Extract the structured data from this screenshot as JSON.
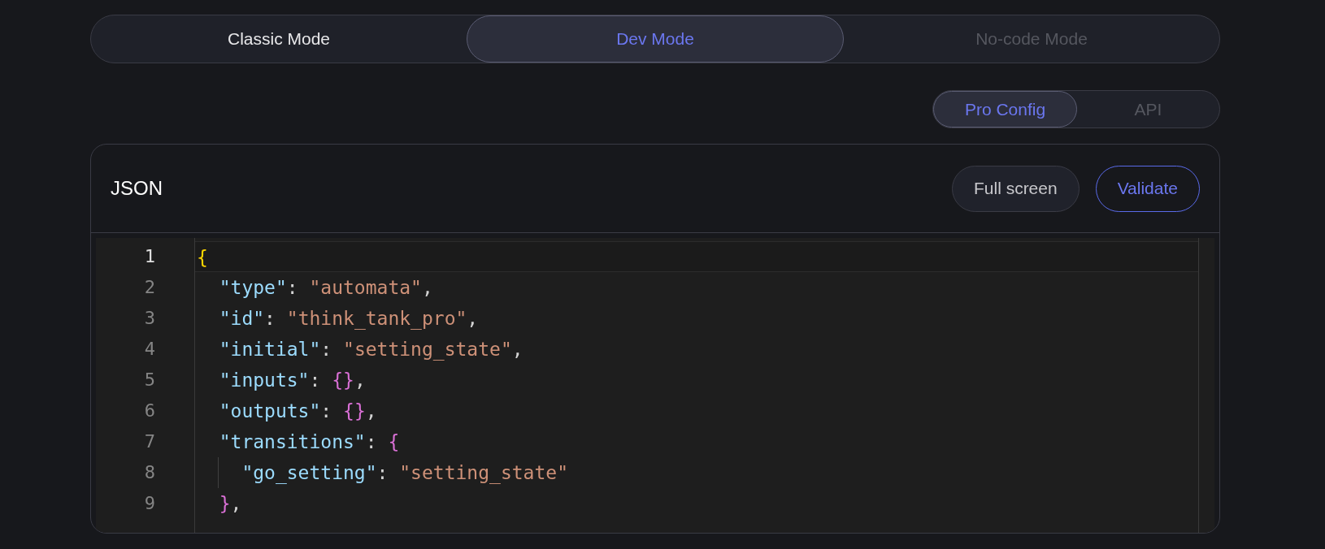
{
  "mode_tabs": [
    {
      "label": "Classic Mode",
      "selected": false,
      "disabled": false
    },
    {
      "label": "Dev Mode",
      "selected": true,
      "disabled": false
    },
    {
      "label": "No-code Mode",
      "selected": false,
      "disabled": true
    }
  ],
  "config_tabs": [
    {
      "label": "Pro Config",
      "selected": true
    },
    {
      "label": "API",
      "selected": false
    }
  ],
  "editor_card": {
    "title": "JSON",
    "buttons": [
      {
        "label": "Full screen",
        "kind": "secondary"
      },
      {
        "label": "Validate",
        "kind": "outline"
      }
    ],
    "lines": [
      {
        "number": "1",
        "active": true,
        "tokens": [
          {
            "kind": "bracket1",
            "text": "{"
          }
        ]
      },
      {
        "number": "2",
        "active": false,
        "tokens": [
          {
            "kind": "key",
            "text": "  \"type\""
          },
          {
            "kind": "punct",
            "text": ": "
          },
          {
            "kind": "string",
            "text": "\"automata\""
          },
          {
            "kind": "punct",
            "text": ","
          }
        ]
      },
      {
        "number": "3",
        "active": false,
        "tokens": [
          {
            "kind": "key",
            "text": "  \"id\""
          },
          {
            "kind": "punct",
            "text": ": "
          },
          {
            "kind": "string",
            "text": "\"think_tank_pro\""
          },
          {
            "kind": "punct",
            "text": ","
          }
        ]
      },
      {
        "number": "4",
        "active": false,
        "tokens": [
          {
            "kind": "key",
            "text": "  \"initial\""
          },
          {
            "kind": "punct",
            "text": ": "
          },
          {
            "kind": "string",
            "text": "\"setting_state\""
          },
          {
            "kind": "punct",
            "text": ","
          }
        ]
      },
      {
        "number": "5",
        "active": false,
        "tokens": [
          {
            "kind": "key",
            "text": "  \"inputs\""
          },
          {
            "kind": "punct",
            "text": ": "
          },
          {
            "kind": "bracket2",
            "text": "{}"
          },
          {
            "kind": "punct",
            "text": ","
          }
        ]
      },
      {
        "number": "6",
        "active": false,
        "tokens": [
          {
            "kind": "key",
            "text": "  \"outputs\""
          },
          {
            "kind": "punct",
            "text": ": "
          },
          {
            "kind": "bracket2",
            "text": "{}"
          },
          {
            "kind": "punct",
            "text": ","
          }
        ]
      },
      {
        "number": "7",
        "active": false,
        "tokens": [
          {
            "kind": "key",
            "text": "  \"transitions\""
          },
          {
            "kind": "punct",
            "text": ": "
          },
          {
            "kind": "bracket2",
            "text": "{"
          }
        ]
      },
      {
        "number": "8",
        "active": false,
        "tokens": [
          {
            "kind": "key",
            "text": "    \"go_setting\""
          },
          {
            "kind": "punct",
            "text": ": "
          },
          {
            "kind": "string",
            "text": "\"setting_state\""
          }
        ]
      },
      {
        "number": "9",
        "active": false,
        "tokens": [
          {
            "kind": "bracket2",
            "text": "  }"
          },
          {
            "kind": "punct",
            "text": ","
          }
        ]
      }
    ]
  }
}
